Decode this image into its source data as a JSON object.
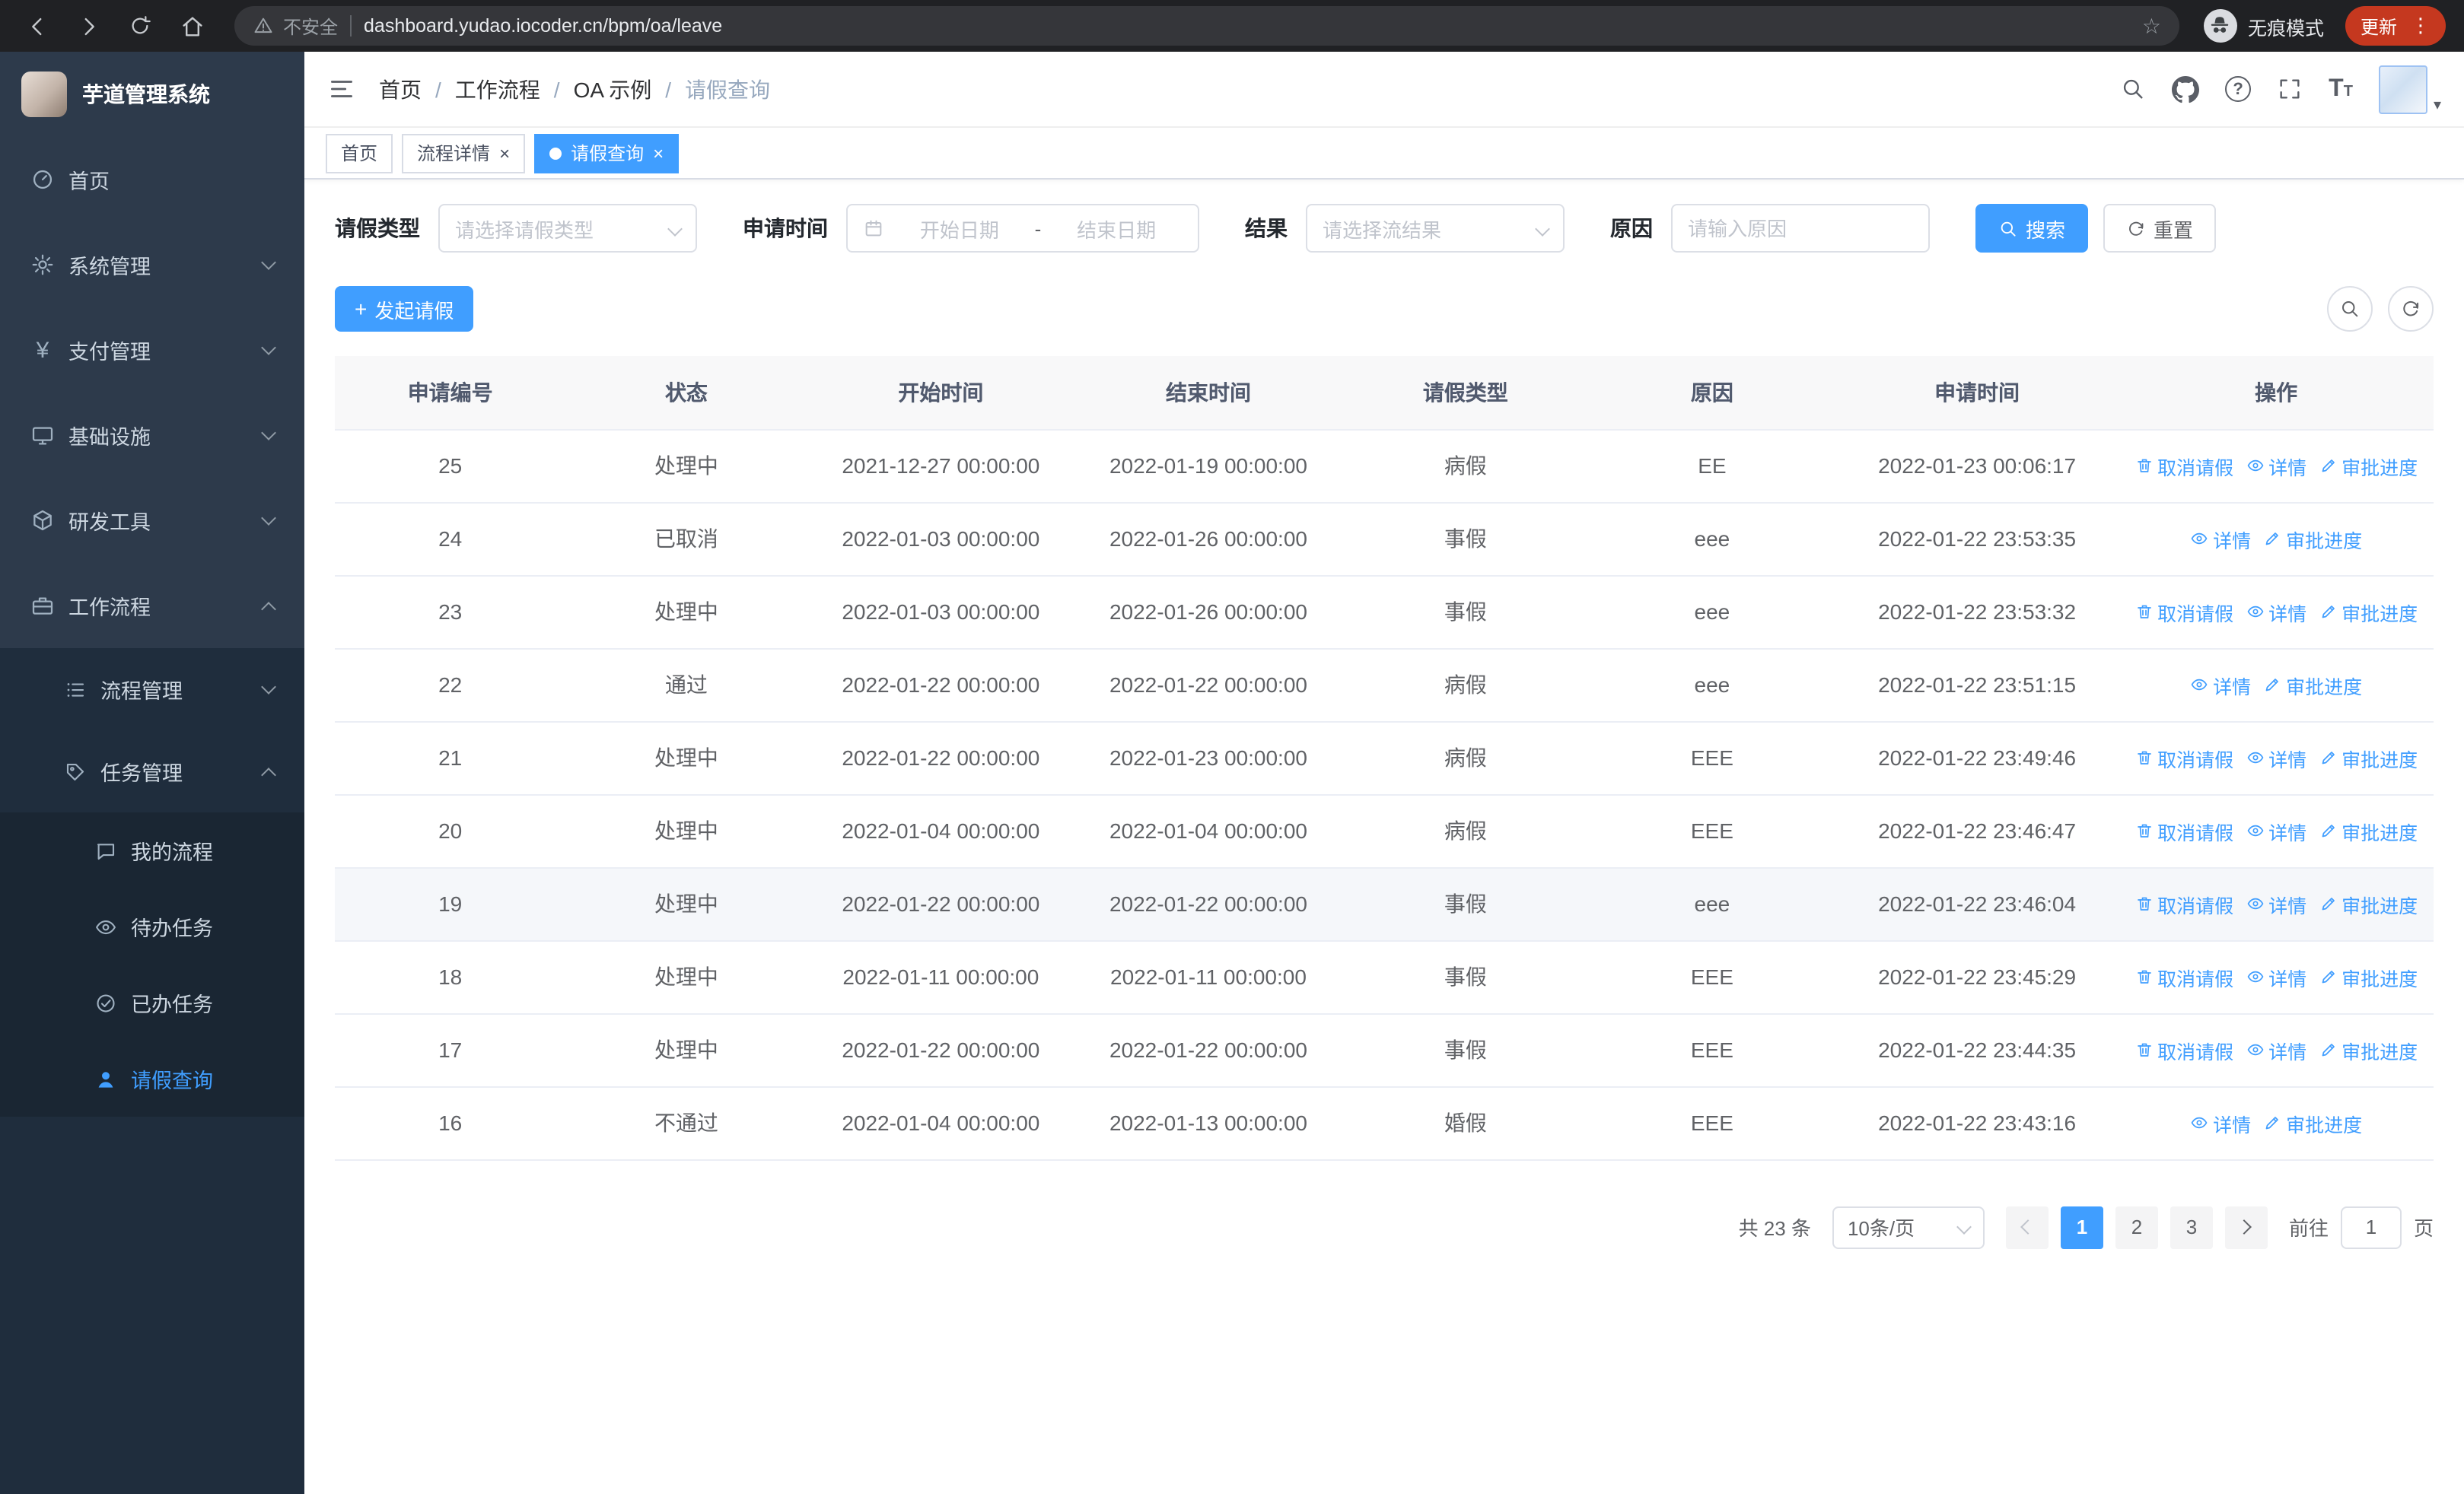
{
  "browser": {
    "security_label": "不安全",
    "url": "dashboard.yudao.iocoder.cn/bpm/oa/leave",
    "incognito_label": "无痕模式",
    "update_label": "更新"
  },
  "icons": {
    "star": "☆",
    "dots": "⋮",
    "close": "×",
    "question": "?",
    "yen": "¥",
    "font_letter": "T",
    "caret": "▾",
    "plus": "+"
  },
  "sidebar": {
    "app_title": "芋道管理系统",
    "menu": {
      "home": "首页",
      "system": "系统管理",
      "payment": "支付管理",
      "infra": "基础设施",
      "devtools": "研发工具",
      "workflow": "工作流程",
      "process_mgmt": "流程管理",
      "task_mgmt": "任务管理",
      "my_process": "我的流程",
      "todo_tasks": "待办任务",
      "done_tasks": "已办任务",
      "leave_query": "请假查询"
    }
  },
  "header": {
    "breadcrumb": [
      "首页",
      "工作流程",
      "OA 示例",
      "请假查询"
    ]
  },
  "tabs": {
    "home": "首页",
    "detail": "流程详情",
    "leave": "请假查询"
  },
  "filters": {
    "leave_type_label": "请假类型",
    "leave_type_placeholder": "请选择请假类型",
    "apply_time_label": "申请时间",
    "date_start_placeholder": "开始日期",
    "date_separator": "-",
    "date_end_placeholder": "结束日期",
    "result_label": "结果",
    "result_placeholder": "请选择流结果",
    "reason_label": "原因",
    "reason_placeholder": "请输入原因",
    "search_button": "搜索",
    "reset_button": "重置"
  },
  "toolbar": {
    "create_button": "发起请假"
  },
  "table": {
    "columns": [
      "申请编号",
      "状态",
      "开始时间",
      "结束时间",
      "请假类型",
      "原因",
      "申请时间",
      "操作"
    ],
    "action_labels": {
      "cancel": "取消请假",
      "detail": "详情",
      "progress": "审批进度"
    },
    "rows": [
      {
        "id": "25",
        "status": "处理中",
        "start": "2021-12-27 00:00:00",
        "end": "2022-01-19 00:00:00",
        "type": "病假",
        "reason": "EE",
        "apply_time": "2022-01-23 00:06:17"
      },
      {
        "id": "24",
        "status": "已取消",
        "start": "2022-01-03 00:00:00",
        "end": "2022-01-26 00:00:00",
        "type": "事假",
        "reason": "eee",
        "apply_time": "2022-01-22 23:53:35"
      },
      {
        "id": "23",
        "status": "处理中",
        "start": "2022-01-03 00:00:00",
        "end": "2022-01-26 00:00:00",
        "type": "事假",
        "reason": "eee",
        "apply_time": "2022-01-22 23:53:32"
      },
      {
        "id": "22",
        "status": "通过",
        "start": "2022-01-22 00:00:00",
        "end": "2022-01-22 00:00:00",
        "type": "病假",
        "reason": "eee",
        "apply_time": "2022-01-22 23:51:15"
      },
      {
        "id": "21",
        "status": "处理中",
        "start": "2022-01-22 00:00:00",
        "end": "2022-01-23 00:00:00",
        "type": "病假",
        "reason": "EEE",
        "apply_time": "2022-01-22 23:49:46"
      },
      {
        "id": "20",
        "status": "处理中",
        "start": "2022-01-04 00:00:00",
        "end": "2022-01-04 00:00:00",
        "type": "病假",
        "reason": "EEE",
        "apply_time": "2022-01-22 23:46:47"
      },
      {
        "id": "19",
        "status": "处理中",
        "start": "2022-01-22 00:00:00",
        "end": "2022-01-22 00:00:00",
        "type": "事假",
        "reason": "eee",
        "apply_time": "2022-01-22 23:46:04"
      },
      {
        "id": "18",
        "status": "处理中",
        "start": "2022-01-11 00:00:00",
        "end": "2022-01-11 00:00:00",
        "type": "事假",
        "reason": "EEE",
        "apply_time": "2022-01-22 23:45:29"
      },
      {
        "id": "17",
        "status": "处理中",
        "start": "2022-01-22 00:00:00",
        "end": "2022-01-22 00:00:00",
        "type": "事假",
        "reason": "EEE",
        "apply_time": "2022-01-22 23:44:35"
      },
      {
        "id": "16",
        "status": "不通过",
        "start": "2022-01-04 00:00:00",
        "end": "2022-01-13 00:00:00",
        "type": "婚假",
        "reason": "EEE",
        "apply_time": "2022-01-22 23:43:16"
      }
    ]
  },
  "pagination": {
    "total_text": "共 23 条",
    "page_size": "10条/页",
    "pages": [
      "1",
      "2",
      "3"
    ],
    "goto_label": "前往",
    "goto_value": "1",
    "goto_suffix": "页"
  },
  "colors": {
    "primary": "#409eff",
    "sidebar_bg": "#1f2d3d",
    "sidebar_item_bg": "#2d3a4b",
    "tab_active_bg": "#409eff",
    "table_header_bg": "#f8f8f9",
    "update_pill_bg": "#c5381f"
  }
}
